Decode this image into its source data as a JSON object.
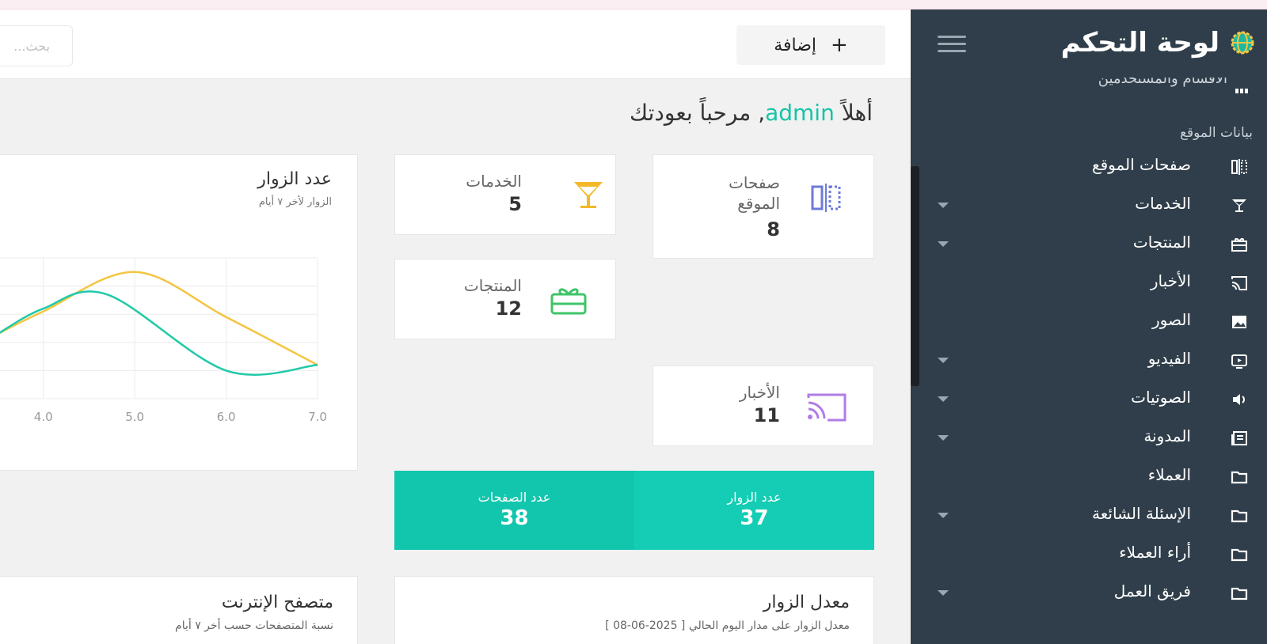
{
  "header": {
    "add_label": "إضافة",
    "search_placeholder": "بحث..."
  },
  "welcome": {
    "greeting": "أهلاً",
    "username": "admin",
    "suffix": ", مرحباً بعودتك"
  },
  "sidebar": {
    "title": "لوحة التحكم",
    "partial_item": "الأقسام والمستخدمين",
    "section_label": "بيانات الموقع",
    "items": [
      {
        "label": "صفحات الموقع",
        "icon": "columns-icon",
        "caret": false
      },
      {
        "label": "الخدمات",
        "icon": "cocktail-icon",
        "caret": true
      },
      {
        "label": "المنتجات",
        "icon": "gift-icon",
        "caret": true
      },
      {
        "label": "الأخبار",
        "icon": "cast-icon",
        "caret": false
      },
      {
        "label": "الصور",
        "icon": "image-icon",
        "caret": false
      },
      {
        "label": "الفيديو",
        "icon": "tv-icon",
        "caret": true
      },
      {
        "label": "الصوتيات",
        "icon": "speaker-icon",
        "caret": true
      },
      {
        "label": "المدونة",
        "icon": "newspaper-icon",
        "caret": true
      },
      {
        "label": "العملاء",
        "icon": "folder-icon",
        "caret": false
      },
      {
        "label": "الإسئلة الشائعة",
        "icon": "folder-icon",
        "caret": true
      },
      {
        "label": "أراء العملاء",
        "icon": "folder-icon",
        "caret": false
      },
      {
        "label": "فريق العمل",
        "icon": "folder-icon",
        "caret": true
      }
    ],
    "accent": "#2f3e4a"
  },
  "cards": {
    "pages": {
      "label_line1": "صفحات",
      "label_line2": "الموقع",
      "value": "8",
      "color": "#6c7bd8"
    },
    "services": {
      "label": "الخدمات",
      "value": "5",
      "color": "#f3b92a"
    },
    "products": {
      "label": "المنتجات",
      "value": "12",
      "color": "#3fc46a"
    },
    "news": {
      "label": "الأخبار",
      "value": "11",
      "color": "#b07ce6"
    }
  },
  "band": {
    "visitors_label": "عدد الزوار",
    "visitors_value": "37",
    "pages_label": "عدد الصفحات",
    "pages_value": "38",
    "color": "#14cdb4"
  },
  "visitors_chart": {
    "title": "عدد الزوار",
    "subtitle": "الزوار لأخر ٧ أيام"
  },
  "chart_data": {
    "type": "line",
    "x_ticks": [
      "4.0",
      "5.0",
      "6.0",
      "7.0"
    ],
    "xlim": [
      3.5,
      7.0
    ],
    "ylim": [
      0,
      5
    ],
    "series": [
      {
        "color": "#f4c542",
        "x": [
          3.5,
          4.0,
          5.0,
          6.0,
          7.0
        ],
        "y": [
          2.3,
          3.1,
          4.5,
          2.9,
          1.2
        ]
      },
      {
        "color": "#20c9a8",
        "x": [
          3.5,
          4.0,
          4.7,
          6.0,
          7.0
        ],
        "y": [
          2.3,
          3.2,
          3.7,
          1.0,
          1.2
        ]
      }
    ]
  },
  "bottom": {
    "rate_title": "معدل الزوار",
    "rate_subtitle": "معدل الزوار على مدار اليوم الحالي [ 2025-06-08 ]",
    "browser_title": "متصفح الإنترنت",
    "browser_subtitle": "نسبة المتصفحات حسب أخر ٧ أيام"
  }
}
